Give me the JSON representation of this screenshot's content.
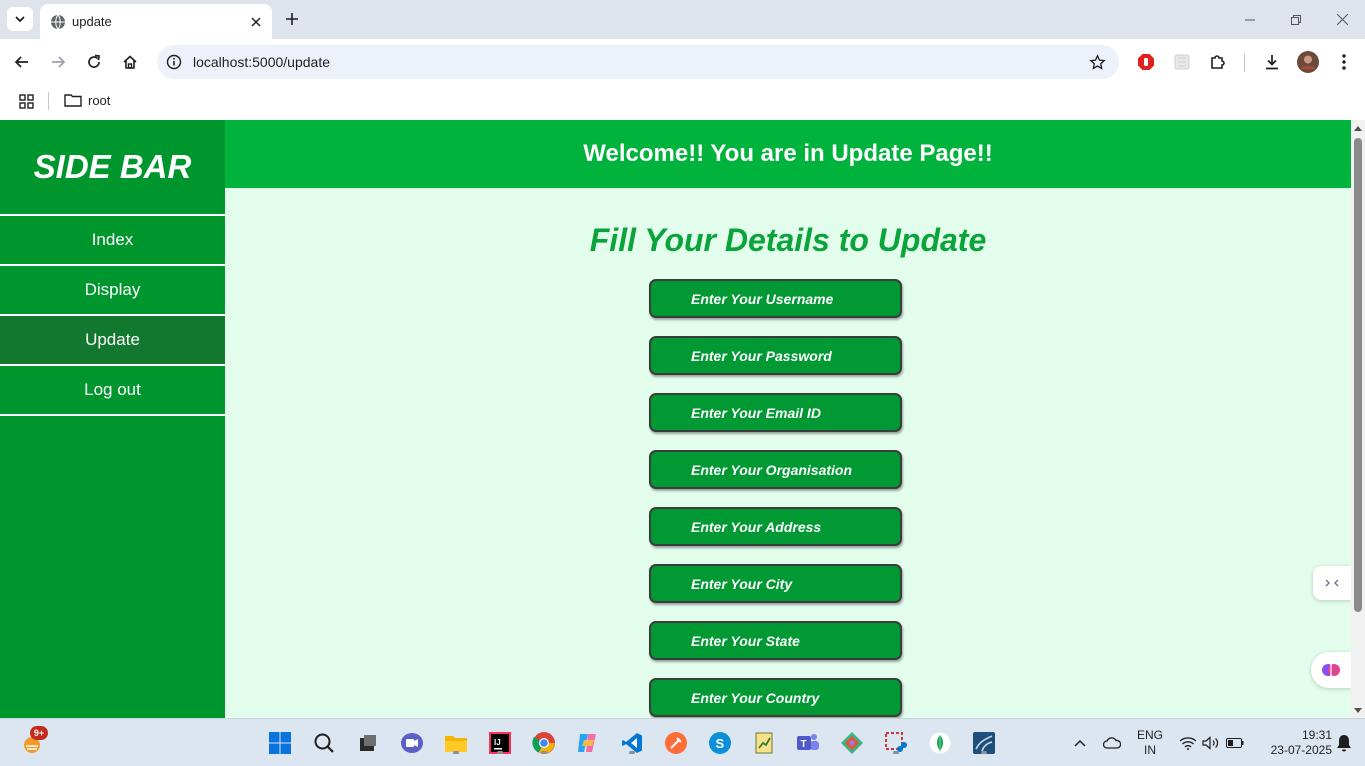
{
  "browser": {
    "tab_title": "update",
    "url": "localhost:5000/update",
    "bookmark_label": "root"
  },
  "sidebar": {
    "title": "SIDE BAR",
    "items": [
      {
        "label": "Index"
      },
      {
        "label": "Display"
      },
      {
        "label": "Update",
        "active": true
      },
      {
        "label": "Log out"
      }
    ]
  },
  "header": {
    "text": "Welcome!! You are in Update Page!!"
  },
  "form": {
    "title": "Fill Your Details to Update",
    "fields": [
      {
        "placeholder": "Enter Your Username"
      },
      {
        "placeholder": "Enter Your Password"
      },
      {
        "placeholder": "Enter Your Email ID"
      },
      {
        "placeholder": "Enter Your Organisation"
      },
      {
        "placeholder": "Enter Your Address"
      },
      {
        "placeholder": "Enter Your City"
      },
      {
        "placeholder": "Enter Your State"
      },
      {
        "placeholder": "Enter Your Country"
      }
    ]
  },
  "taskbar": {
    "notification_badge": "9+",
    "language": "ENG",
    "region": "IN",
    "time": "19:31",
    "date": "23-07-2025"
  },
  "colors": {
    "sidebar": "#00962e",
    "sidebar_active": "#13782f",
    "header": "#00b33c",
    "content_bg": "#e2fdec",
    "form_title": "#0aa43a",
    "field_bg": "#009933"
  }
}
